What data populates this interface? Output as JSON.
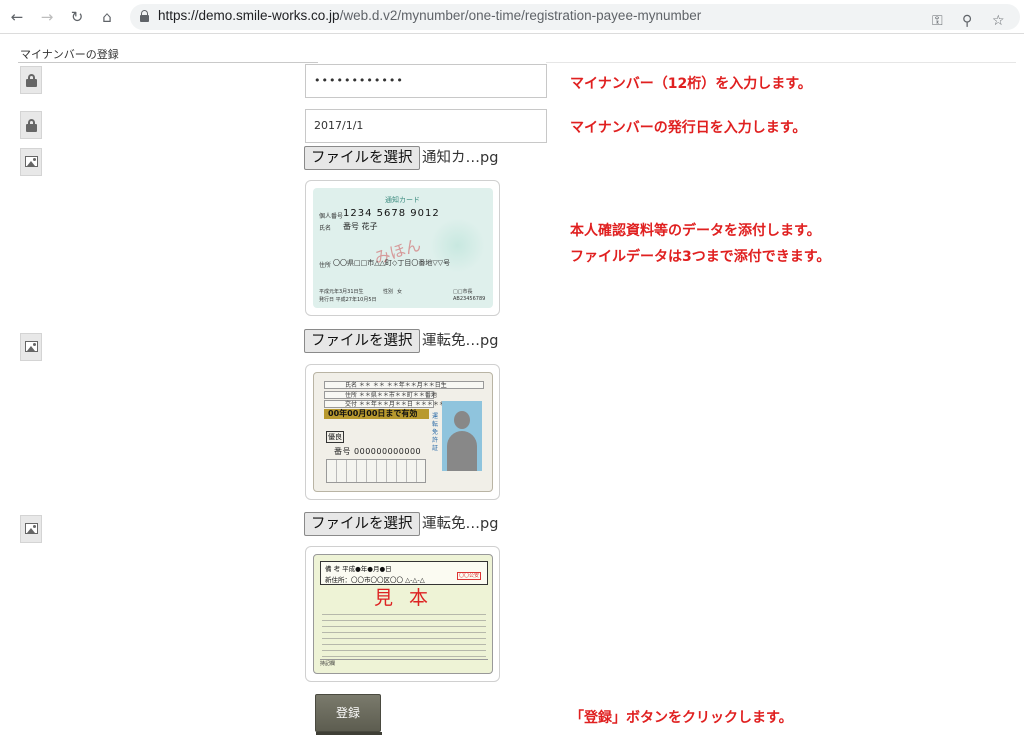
{
  "browser": {
    "url_host": "https://demo.smile-works.co.jp",
    "url_path": "/web.d.v2/mynumber/one-time/registration-payee-mynumber",
    "icons": [
      "back-arrow-icon",
      "forward-arrow-icon",
      "reload-icon",
      "home-icon",
      "lock-icon",
      "key-icon",
      "zoom-icon",
      "star-icon"
    ]
  },
  "page": {
    "heading": "マイナンバーの登録"
  },
  "form": {
    "mynumber_value": "••••••••••••",
    "issue_date_value": "2017/1/1",
    "file_button_label": "ファイルを選択",
    "files": [
      {
        "name": "通知カ…pg"
      },
      {
        "name": "運転免…pg"
      },
      {
        "name": "運転免…pg"
      }
    ],
    "submit_label": "登録"
  },
  "cards": {
    "notice": {
      "title": "通知カード",
      "number_label": "個人番号",
      "number": "1234 5678 9012",
      "name_label": "氏名",
      "name": "番号 花子",
      "stamp": "みほん",
      "address_label": "住所",
      "address": "〇〇県□□市△△町◇丁目〇番地▽▽号",
      "birth": "平成元年3月31日生",
      "sex_label": "性別",
      "sex": "女",
      "issued": "発行日 平成27年10月5日",
      "city": "□□市長",
      "serial": "AB23456789"
    },
    "license": {
      "name_row": "氏名  ＊＊  ＊＊    ＊＊年＊＊月＊＊日生",
      "address_row": "住所 ＊＊県＊＊市＊＊町＊＊番地",
      "issue_row": "交付 ＊＊年＊＊月＊＊日  ＊＊＊＊＊",
      "valid_until": "00年00月00日まで有効",
      "badge": "優良",
      "number": "番号 000000000000",
      "vertical": "運転免許証"
    },
    "license_back": {
      "row1": "備 考 平成●年●月●日",
      "row2": "新住所：〇〇市〇〇区〇〇 △-△-△",
      "red_box": "〇〇公安",
      "mihon": "見本",
      "footer": "持記欄"
    }
  },
  "notes": {
    "mynumber": "マイナンバー（12桁）を入力します。",
    "issue_date": "マイナンバーの発行日を入力します。",
    "attach_line1": "本人確認資料等のデータを添付します。",
    "attach_line2": "ファイルデータは3つまで添付できます。",
    "submit": "「登録」ボタンをクリックします。"
  },
  "colors": {
    "note_red": "#e02020",
    "submit_bg": "#66665a"
  }
}
